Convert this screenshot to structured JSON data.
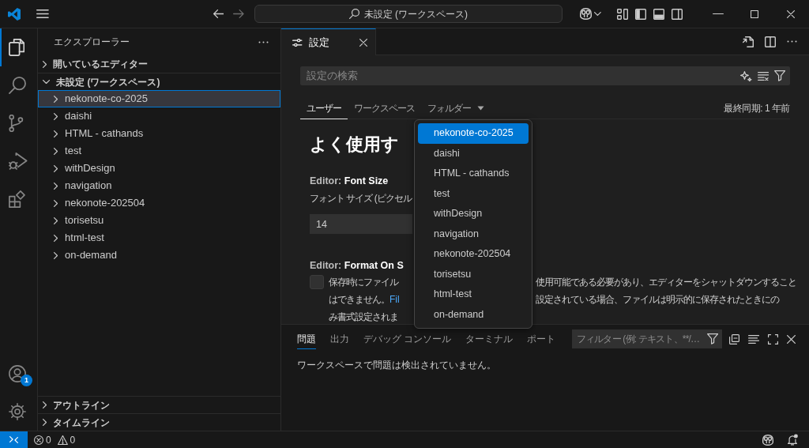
{
  "title_bar": {
    "command_center": "未設定 (ワークスペース)"
  },
  "activity_bar": {
    "items": [
      {
        "kind": "explorer",
        "selected": true
      },
      {
        "kind": "search",
        "selected": false
      },
      {
        "kind": "source-control",
        "selected": false
      },
      {
        "kind": "run-debug",
        "selected": false
      },
      {
        "kind": "extensions",
        "selected": false
      }
    ],
    "accounts_badge": "1"
  },
  "sidebar": {
    "title": "エクスプローラー",
    "sections": [
      {
        "label": "開いているエディター",
        "expanded": false
      },
      {
        "label": "未設定 (ワークスペース)",
        "expanded": true,
        "items": [
          {
            "label": "nekonote-co-2025",
            "expanded": false,
            "selected": true
          },
          {
            "label": "daishi",
            "expanded": false,
            "selected": false
          },
          {
            "label": "HTML - cathands",
            "expanded": false,
            "selected": false
          },
          {
            "label": "test",
            "expanded": false,
            "selected": false
          },
          {
            "label": "withDesign",
            "expanded": false,
            "selected": false
          },
          {
            "label": "navigation",
            "expanded": false,
            "selected": false
          },
          {
            "label": "nekonote-202504",
            "expanded": false,
            "selected": false
          },
          {
            "label": "torisetsu",
            "expanded": false,
            "selected": false
          },
          {
            "label": "html-test",
            "expanded": false,
            "selected": false
          },
          {
            "label": "on-demand",
            "expanded": false,
            "selected": false
          }
        ]
      }
    ],
    "bottom_sections": [
      {
        "label": "アウトライン",
        "expanded": false
      },
      {
        "label": "タイムライン",
        "expanded": false
      }
    ]
  },
  "editor": {
    "tabs": [
      {
        "label": "設定",
        "selected": true
      }
    ],
    "search": {
      "placeholder": "設定の検索"
    },
    "scope_tabs": [
      {
        "label": "ユーザー",
        "kind": "tab",
        "selected": true
      },
      {
        "label": "ワークスペース",
        "kind": "tab",
        "selected": false
      },
      {
        "label": "フォルダー",
        "kind": "dropdown",
        "selected": false
      }
    ],
    "last_sync": "最終同期: 1 年前",
    "heading": "よく使用す",
    "entries": [
      {
        "kind": "number",
        "title": "Editor: **Font Size**",
        "description": "フォント サイズ (ピクセル",
        "value": "14"
      },
      {
        "kind": "checkbox",
        "title": "Editor: **Format On S**",
        "checked": false,
        "description_lines": [
          {
            "left": "保存時にファイル",
            "right": "使用可能である必要があり、エディターをシャットダウンすること"
          },
          {
            "left": "はできません。",
            "link": "Fil",
            "right": "設定されている場合、ファイルは明示的に保存されたときにの"
          },
          {
            "left": "み書式設定されま"
          }
        ]
      }
    ]
  },
  "folder_dropdown": {
    "items": [
      {
        "label": "nekonote-co-2025",
        "selected": true
      },
      {
        "label": "daishi",
        "selected": false
      },
      {
        "label": "HTML - cathands",
        "selected": false
      },
      {
        "label": "test",
        "selected": false
      },
      {
        "label": "withDesign",
        "selected": false
      },
      {
        "label": "navigation",
        "selected": false
      },
      {
        "label": "nekonote-202504",
        "selected": false
      },
      {
        "label": "torisetsu",
        "selected": false
      },
      {
        "label": "html-test",
        "selected": false
      },
      {
        "label": "on-demand",
        "selected": false
      }
    ]
  },
  "panel": {
    "tabs": [
      {
        "label": "問題",
        "selected": true
      },
      {
        "label": "出力",
        "selected": false
      },
      {
        "label": "デバッグ コンソール",
        "selected": false
      },
      {
        "label": "ターミナル",
        "selected": false
      },
      {
        "label": "ポート",
        "selected": false
      }
    ],
    "filter": {
      "placeholder": "フィルター (例: テキスト、**/…"
    },
    "message": "ワークスペースで問題は検出されていません。"
  },
  "status_bar": {
    "errors": "0",
    "warnings": "0"
  }
}
